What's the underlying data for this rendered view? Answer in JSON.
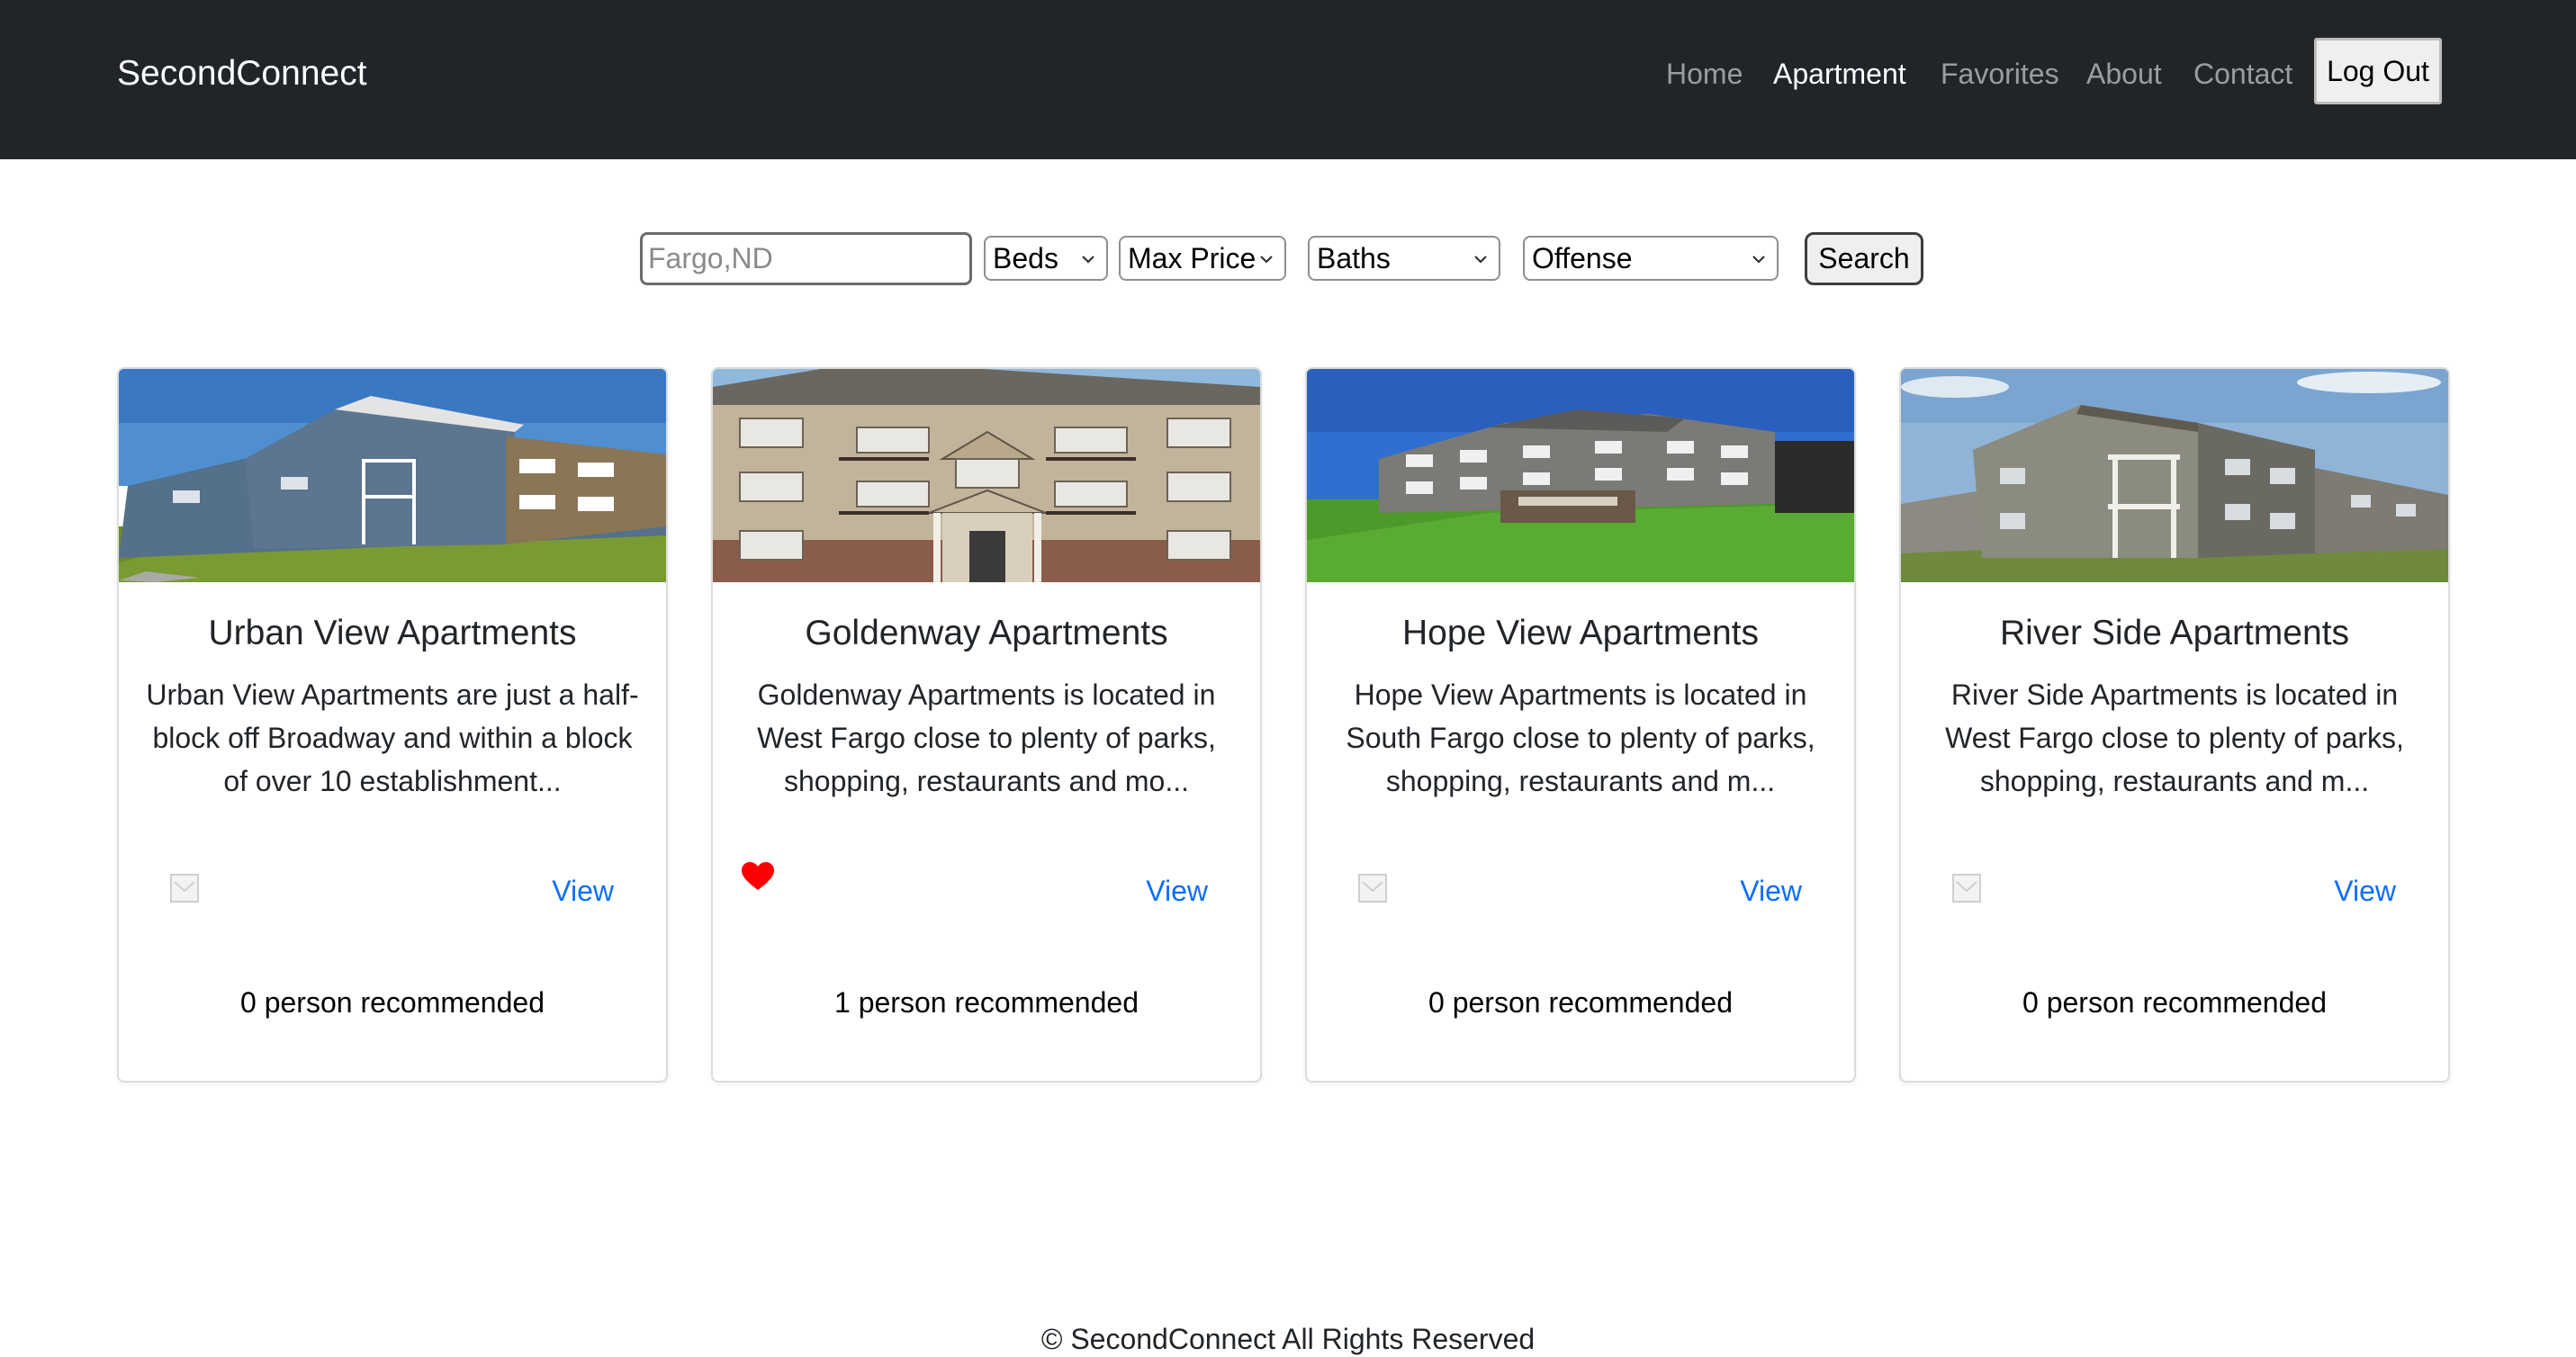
{
  "navbar": {
    "brand": "SecondConnect",
    "links": [
      {
        "label": "Home",
        "active": false
      },
      {
        "label": "Apartment",
        "active": true
      },
      {
        "label": "Favorites",
        "active": false
      },
      {
        "label": "About",
        "active": false
      },
      {
        "label": "Contact",
        "active": false
      }
    ],
    "logout_label": "Log Out",
    "background": "#212529"
  },
  "search": {
    "location_placeholder": "Fargo,ND",
    "location_value": "",
    "beds": "Beds",
    "max_price": "Max Price",
    "baths": "Baths",
    "offense": "Offense",
    "submit_label": "Search"
  },
  "listings": [
    {
      "title": "Urban View Apartments",
      "description": "Urban View Apartments are just a half-block off Broadway and within a block of over 10 establishment...",
      "favorited": false,
      "view_label": "View",
      "recommended": "0 person recommended"
    },
    {
      "title": "Goldenway Apartments",
      "description": "Goldenway Apartments is located in West Fargo close to plenty of parks, shopping, restaurants and mo...",
      "favorited": true,
      "view_label": "View",
      "recommended": "1 person recommended"
    },
    {
      "title": "Hope View Apartments",
      "description": "Hope View Apartments is located in South Fargo close to plenty of parks, shopping, restaurants and m...",
      "favorited": false,
      "view_label": "View",
      "recommended": "0 person recommended"
    },
    {
      "title": "River Side Apartments",
      "description": "River Side Apartments is located in West Fargo close to plenty of parks, shopping, restaurants and m...",
      "favorited": false,
      "view_label": "View",
      "recommended": "0 person recommended"
    }
  ],
  "footer": {
    "text": "© SecondConnect All Rights Reserved"
  },
  "colors": {
    "link_blue": "#0d6efd",
    "heart_red": "#ff0000"
  }
}
